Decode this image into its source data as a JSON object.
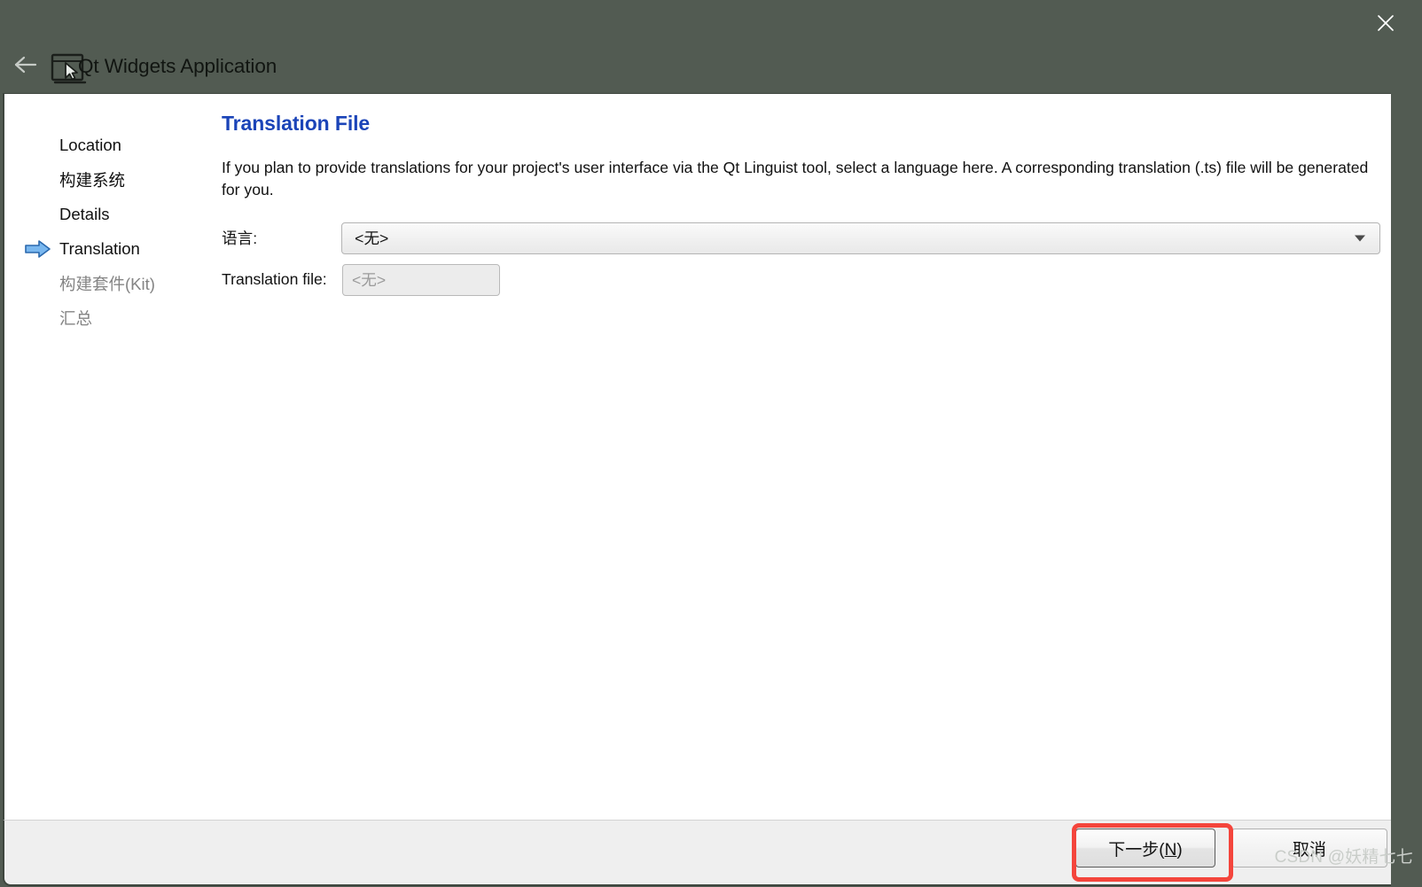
{
  "window": {
    "title": "Qt Widgets Application",
    "close_icon": "close-icon",
    "back_icon": "back-arrow-icon",
    "app_icon": "qt-widgets-window-icon",
    "header_color": "#525b52"
  },
  "sidebar": {
    "items": [
      {
        "label": "Location",
        "state": "done"
      },
      {
        "label": "构建系统",
        "state": "done"
      },
      {
        "label": "Details",
        "state": "done"
      },
      {
        "label": "Translation",
        "state": "current"
      },
      {
        "label": "构建套件(Kit)",
        "state": "disabled"
      },
      {
        "label": "汇总",
        "state": "disabled"
      }
    ],
    "current_marker_icon": "blue-arrow-icon"
  },
  "main": {
    "page_title": "Translation File",
    "page_title_color": "#1b44b8",
    "description": "If you plan to provide translations for your project's user interface via the Qt Linguist tool, select a language here. A corresponding translation (.ts) file will be generated for you.",
    "form": {
      "language": {
        "label": "语言:",
        "value": "<无>",
        "dropdown_icon": "chevron-down-icon"
      },
      "translation_file": {
        "label": "Translation file:",
        "value": "<无>",
        "enabled": false
      }
    }
  },
  "footer": {
    "next_label_prefix": "下一步(",
    "next_accel": "N",
    "next_label_suffix": ")",
    "next_label": "下一步(N)",
    "cancel_label": "取消",
    "highlight_color": "#f4453c"
  },
  "watermark": {
    "text": "CSDN @妖精七七"
  }
}
